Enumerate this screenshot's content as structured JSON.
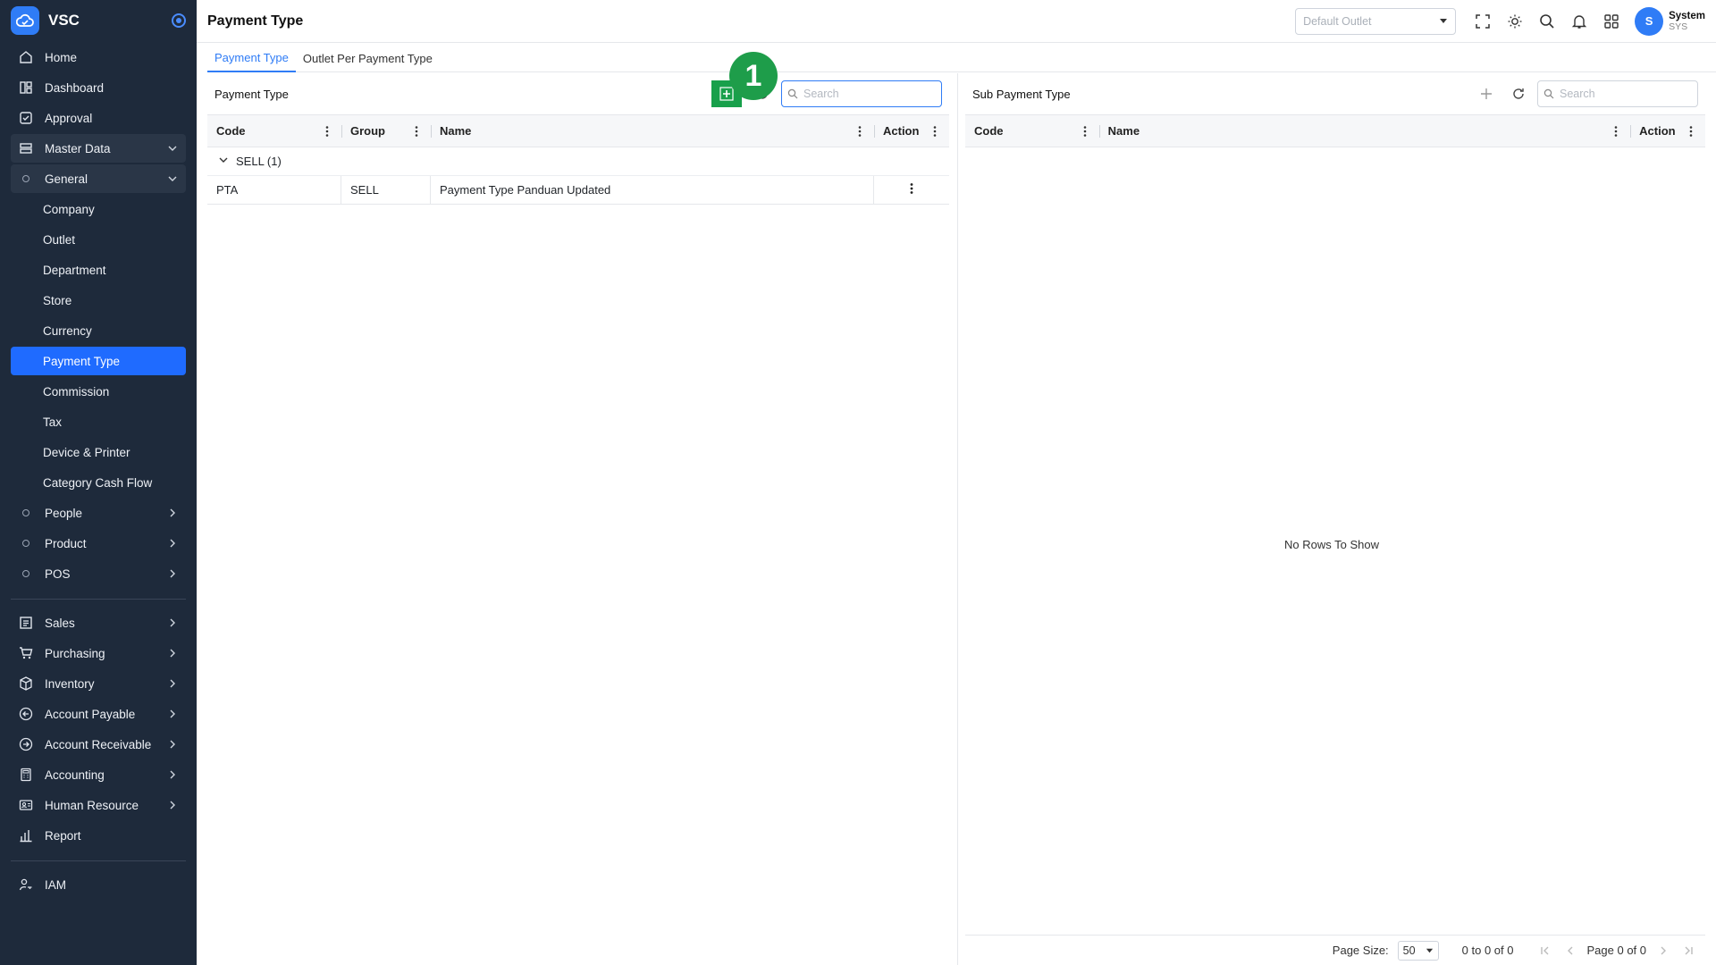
{
  "app": {
    "name": "VSC"
  },
  "header": {
    "title": "Payment Type",
    "outlet_placeholder": "Default Outlet",
    "user": {
      "initial": "S",
      "name": "System",
      "code": "SYS"
    }
  },
  "sidebar": {
    "items": [
      {
        "label": "Home",
        "icon": "home-icon"
      },
      {
        "label": "Dashboard",
        "icon": "dashboard-icon"
      },
      {
        "label": "Approval",
        "icon": "approval-icon"
      },
      {
        "label": "Master Data",
        "icon": "master-data-icon"
      },
      {
        "label": "General",
        "icon": "dot-icon"
      },
      {
        "label": "Company"
      },
      {
        "label": "Outlet"
      },
      {
        "label": "Department"
      },
      {
        "label": "Store"
      },
      {
        "label": "Currency"
      },
      {
        "label": "Payment Type"
      },
      {
        "label": "Commission"
      },
      {
        "label": "Tax"
      },
      {
        "label": "Device & Printer"
      },
      {
        "label": "Category Cash Flow"
      },
      {
        "label": "People",
        "icon": "dot-icon"
      },
      {
        "label": "Product",
        "icon": "dot-icon"
      },
      {
        "label": "POS",
        "icon": "dot-icon"
      },
      {
        "label": "Sales",
        "icon": "sales-icon"
      },
      {
        "label": "Purchasing",
        "icon": "cart-icon"
      },
      {
        "label": "Inventory",
        "icon": "box-icon"
      },
      {
        "label": "Account Payable",
        "icon": "arrow-left-circle-icon"
      },
      {
        "label": "Account Receivable",
        "icon": "arrow-right-circle-icon"
      },
      {
        "label": "Accounting",
        "icon": "calculator-icon"
      },
      {
        "label": "Human Resource",
        "icon": "id-card-icon"
      },
      {
        "label": "Report",
        "icon": "bar-chart-icon"
      },
      {
        "label": "IAM",
        "icon": "user-key-icon"
      }
    ]
  },
  "tabs": [
    "Payment Type",
    "Outlet Per Payment Type"
  ],
  "left_panel": {
    "title": "Payment Type",
    "search_placeholder": "Search",
    "columns": [
      "Code",
      "Group",
      "Name",
      "Action"
    ],
    "group_row": "SELL (1)",
    "rows": [
      {
        "code": "PTA",
        "group": "SELL",
        "name": "Payment Type Panduan Updated"
      }
    ],
    "step_badge": "1"
  },
  "right_panel": {
    "title": "Sub Payment Type",
    "search_placeholder": "Search",
    "columns": [
      "Code",
      "Name",
      "Action"
    ],
    "empty_text": "No Rows To Show",
    "footer": {
      "page_size_label": "Page Size:",
      "page_size": "50",
      "range": "0 to 0 of 0",
      "page": "Page 0 of 0"
    }
  },
  "colors": {
    "sidebar_bg": "#1e2a3b",
    "accent": "#2f7cf6",
    "active_item": "#1f6bff",
    "highlight": "#18a04b"
  }
}
